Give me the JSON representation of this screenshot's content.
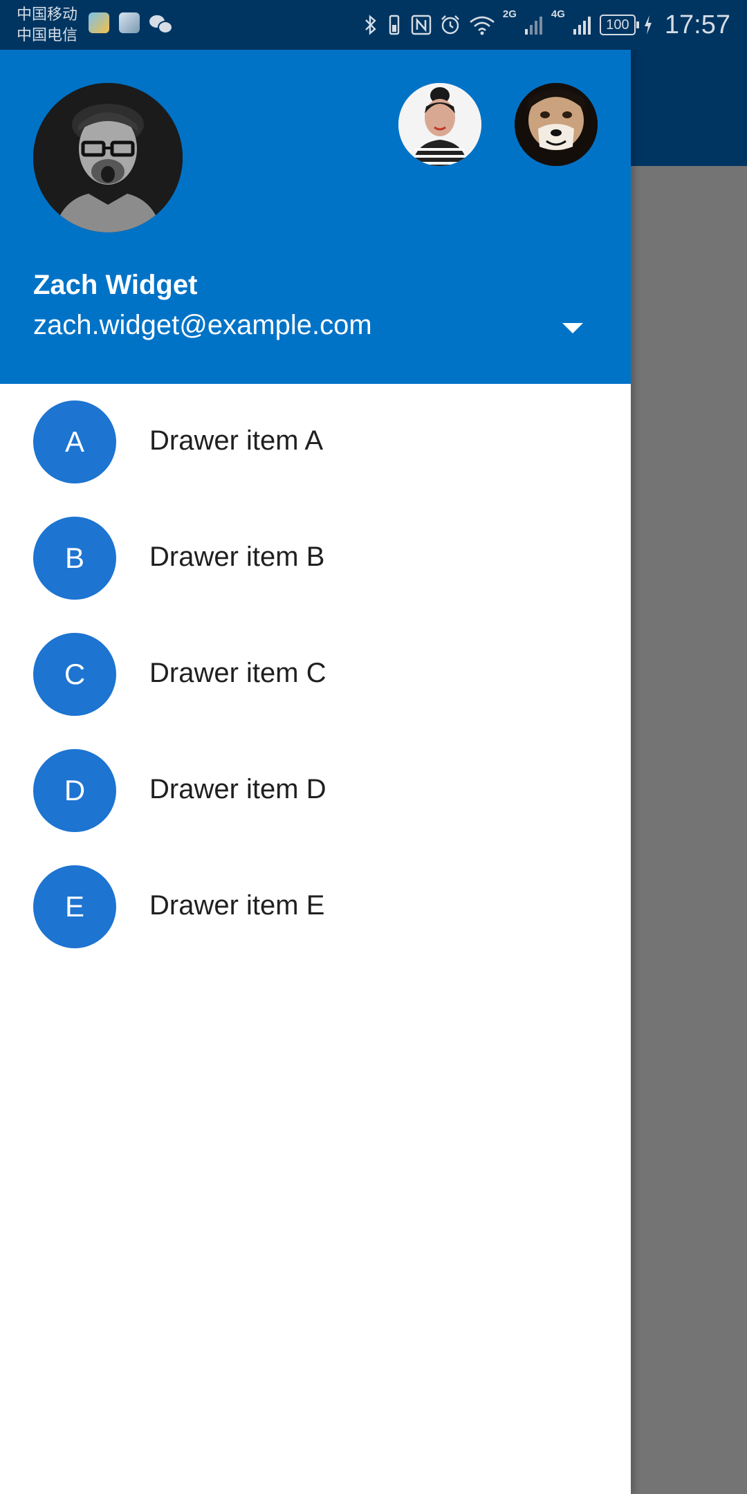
{
  "status_bar": {
    "carrier_1": "中国移动",
    "carrier_2": "中国电信",
    "notification_icons": [
      "app-box-icon",
      "reader-app-icon",
      "wechat-icon"
    ],
    "network_2g": "2G",
    "network_4g": "4G",
    "battery": "100",
    "time": "17:57"
  },
  "drawer_header": {
    "background_color": "#0073c7",
    "account_name": "Zach Widget",
    "account_email": "zach.widget@example.com"
  },
  "drawer_items": [
    {
      "letter": "A",
      "label": "Drawer item A"
    },
    {
      "letter": "B",
      "label": "Drawer item B"
    },
    {
      "letter": "C",
      "label": "Drawer item C"
    },
    {
      "letter": "D",
      "label": "Drawer item D"
    },
    {
      "letter": "E",
      "label": "Drawer item E"
    }
  ],
  "colors": {
    "item_avatar": "#1d74d1",
    "app_bar": "#003561",
    "scrim": "#747474"
  }
}
